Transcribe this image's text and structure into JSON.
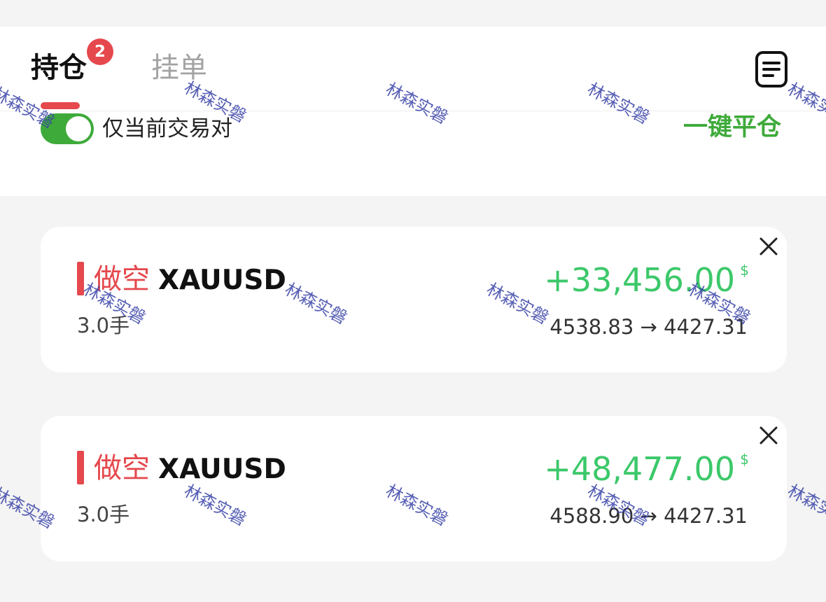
{
  "tabs": [
    {
      "label": "持仓",
      "badge": "2",
      "active": true
    },
    {
      "label": "挂单",
      "active": false
    }
  ],
  "header": {
    "doc_icon": "document-list-icon"
  },
  "filter": {
    "toggle_on": true,
    "label": "仅当前交易对"
  },
  "actions": {
    "close_all_label": "一键平仓"
  },
  "positions": [
    {
      "direction": "做空",
      "symbol": "XAUUSD",
      "lots": "3.0手",
      "pnl": "+33,456.00",
      "currency": "$",
      "open_price": "4538.83",
      "arrow": "→",
      "current_price": "4427.31"
    },
    {
      "direction": "做空",
      "symbol": "XAUUSD",
      "lots": "3.0手",
      "pnl": "+48,477.00",
      "currency": "$",
      "open_price": "4588.90",
      "arrow": "→",
      "current_price": "4427.31"
    }
  ],
  "watermark": "林森实磐",
  "colors": {
    "accent_red": "#e5484d",
    "profit_green": "#3cc86a",
    "toggle_green": "#3eaa3a",
    "watermark_blue": "#3a44a8"
  }
}
